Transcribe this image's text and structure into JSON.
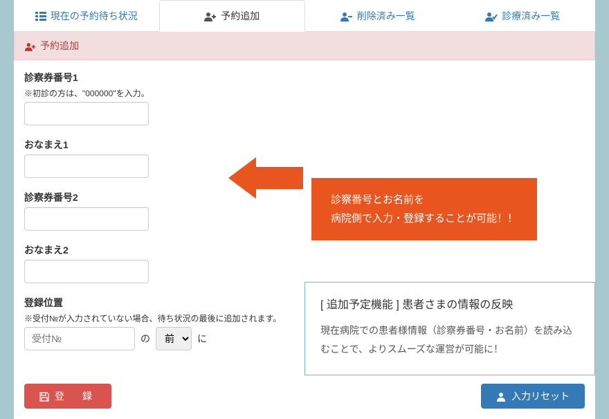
{
  "tabs": [
    {
      "label": "現在の予約待ち状況",
      "icon": "list-icon"
    },
    {
      "label": "予約追加",
      "icon": "user-plus-icon"
    },
    {
      "label": "削除済み一覧",
      "icon": "user-minus-icon"
    },
    {
      "label": "診療済み一覧",
      "icon": "user-check-icon"
    }
  ],
  "panel_header": "予約追加",
  "form": {
    "ticket1_label": "診察券番号1",
    "ticket1_hint": "※初診の方は、\"000000\"を入力。",
    "name1_label": "おなまえ1",
    "ticket2_label": "診察券番号2",
    "name2_label": "おなまえ2",
    "position_label": "登録位置",
    "position_hint": "※受付№が入力されていない場合、待ち状況の最後に追加されます。",
    "position_placeholder": "受付№",
    "position_no_text": "の",
    "position_select": "前",
    "position_ni_text": "に"
  },
  "callout": {
    "line1": "診察番号とお名前を",
    "line2": "病院側で入力・登録することが可能！！"
  },
  "info": {
    "title": "[ 追加予定機能 ] 患者さまの情報の反映",
    "body": "現在病院での患者様情報（診察券番号・お名前）を読み込むことで、よりスムーズな運営が可能に！"
  },
  "buttons": {
    "register": "登　録",
    "reset": "入力リセット"
  }
}
